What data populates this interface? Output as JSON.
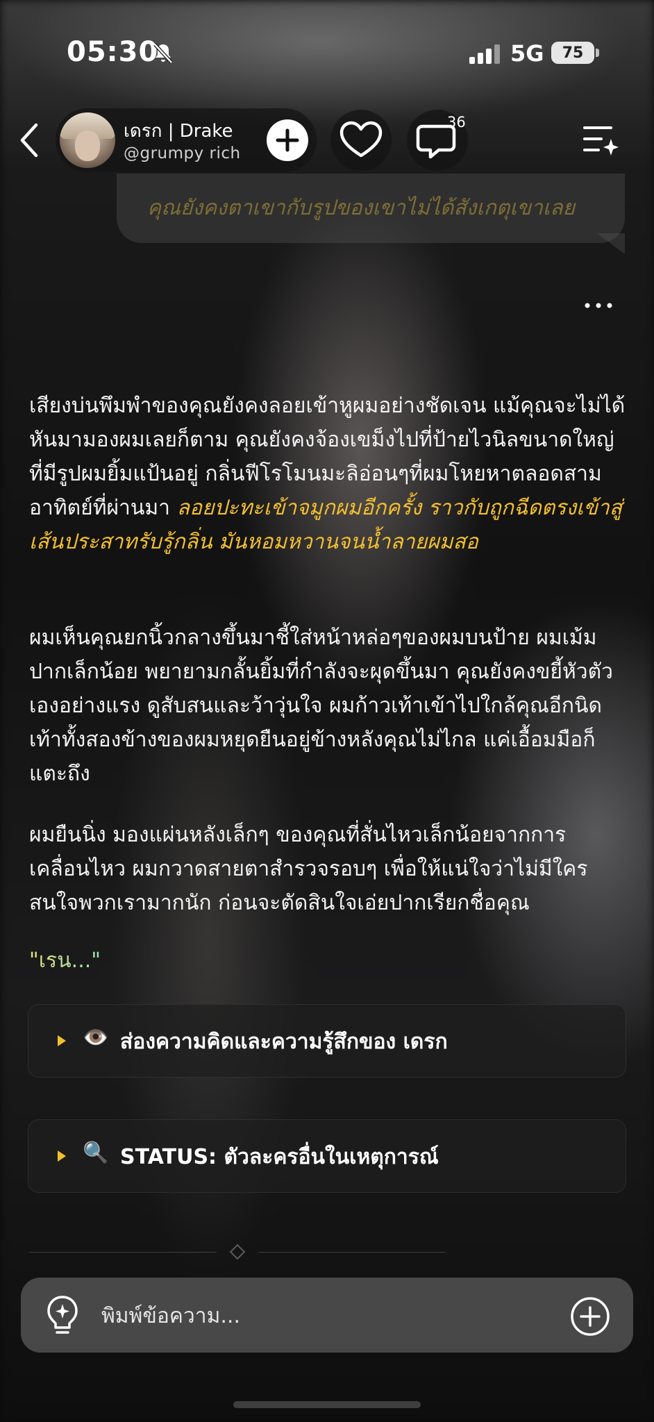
{
  "status_bar": {
    "time": "05:30",
    "network": "5G",
    "battery": "75"
  },
  "header": {
    "character_name": "เดรก | Drake",
    "character_handle": "@grumpy rich",
    "comment_count": "36"
  },
  "previous_message": {
    "text": "คุณยังคงตาเขากับรูปของเขาไม่ได้สังเกตุเขาเลย"
  },
  "story": {
    "p1_text": "เสียงบ่นพึมพำของคุณยังคงลอยเข้าหูผมอย่างชัดเจน แม้คุณจะไม่ได้หันมามองผมเลยก็ตาม คุณยังคงจ้องเขม็งไปที่ป้ายไวนิลขนาดใหญ่ที่มีรูปผมยิ้มแป้นอยู่ กลิ่นฟีโรโมนมะลิอ่อนๆที่ผมโหยหาตลอดสามอาทิตย์ที่ผ่านมา ",
    "p1_highlight": "ลอยปะทะเข้าจมูกผมอีกครั้ง ราวกับถูกฉีดตรงเข้าสู่เส้นประสาทรับรู้กลิ่น มันหอมหวานจนน้ำลายผมสอ",
    "p2": "ผมเห็นคุณยกนิ้วกลางขึ้นมาชี้ใส่หน้าหล่อๆของผมบนป้าย ผมเม้มปากเล็กน้อย พยายามกลั้นยิ้มที่กำลังจะผุดขึ้นมา คุณยังคงขยี้หัวตัวเองอย่างแรง ดูสับสนและว้าวุ่นใจ ผมก้าวเท้าเข้าไปใกล้คุณอีกนิด เท้าทั้งสองข้างของผมหยุดยืนอยู่ข้างหลังคุณไม่ไกล แค่เอื้อมมือก็แตะถึง",
    "p3": "ผมยืนนิ่ง มองแผ่นหลังเล็กๆ ของคุณที่สั่นไหวเล็กน้อยจากการเคลื่อนไหว ผมกวาดสายตาสำรวจรอบๆ เพื่อให้แน่ใจว่าไม่มีใครสนใจพวกเรามากนัก ก่อนจะตัดสินใจเอ่ยปากเรียกชื่อคุณ",
    "dialog": "\"เรน...\""
  },
  "cards": [
    {
      "emoji": "👁️",
      "title": "ส่องความคิดและความรู้สึกของ เดรก"
    },
    {
      "emoji": "🔍",
      "title": "STATUS: ตัวละครอื่นในเหตุการณ์"
    }
  ],
  "input": {
    "placeholder": "พิมพ์ข้อความ..."
  },
  "colors": {
    "highlight": "#f2bf2e",
    "caret": "#f2bf2e",
    "dialog_gradient_start": "#e8dd74",
    "dialog_gradient_end": "#98e2b4"
  },
  "icons": [
    "bell-off-icon",
    "signal-icon",
    "battery-icon",
    "back-icon",
    "plus-icon",
    "heart-icon",
    "comment-icon",
    "menu-sparkle-icon",
    "more-icon",
    "bulb-icon",
    "add-circle-icon"
  ]
}
